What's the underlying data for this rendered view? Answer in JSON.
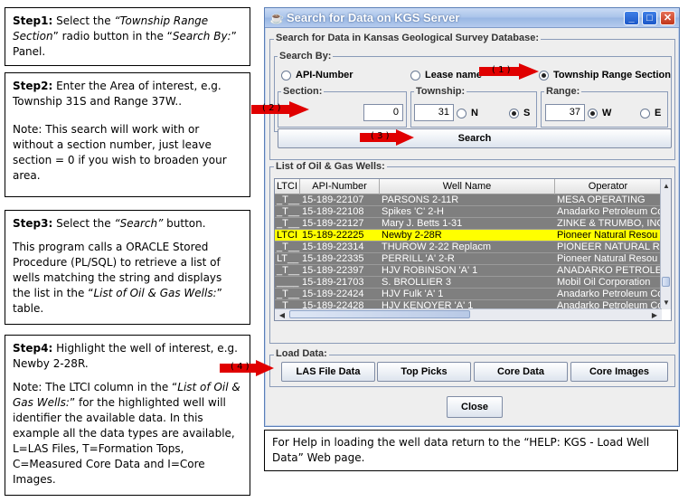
{
  "steps": {
    "s1": {
      "head": "Step1:",
      "t1": " Select the ",
      "i1": "“Township Range Section",
      "t2": "” radio button in the “",
      "i2": "Search By:",
      "t3": "” Panel."
    },
    "s2": {
      "head": "Step2:",
      "t1": " Enter the Area of interest, e.g. Township 31S and Range 37W..",
      "note": "Note: This search will work with or without a section number, just leave section = 0 if you wish to broaden your area."
    },
    "s3": {
      "head": "Step3:",
      "t1": " Select the ",
      "i1": "“Search”",
      "t2": " button.",
      "p2a": "This program calls  a ORACLE Stored Procedure (PL/SQL) to retrieve a list of wells matching the string and displays the list in the “",
      "i2": "List of Oil & Gas Wells:",
      "p2b": "”  table."
    },
    "s4": {
      "head": "Step4:",
      "t1": " Highlight the well of interest, e.g. Newby 2-28R.",
      "n1": "Note: The LTCI column in the “",
      "i1": "List of Oil & Gas Wells:",
      "n2": "” for the highlighted well will identifier the available data. In this example all the data types are available, L=LAS Files, T=Formation Tops, C=Measured Core Data and I=Core Images."
    }
  },
  "window": {
    "title": "Search for Data on KGS Server",
    "db_group": "Search for Data in Kansas Geological Survey Database:",
    "search_by": {
      "label": "Search By:",
      "options": [
        "API-Number",
        "Lease name",
        "Township Range Section"
      ],
      "selected": "Township Range Section"
    },
    "section": {
      "label": "Section:",
      "value": "0"
    },
    "township": {
      "label": "Township:",
      "value": "31",
      "dir_n": "N",
      "dir_s": "S"
    },
    "range": {
      "label": "Range:",
      "value": "37",
      "dir_w": "W",
      "dir_e": "E"
    },
    "search_button": "Search",
    "list_label": "List of Oil & Gas Wells:",
    "columns": [
      "LTCI",
      "API-Number",
      "Well Name",
      "Operator"
    ],
    "rows": [
      [
        "_T__",
        "15-189-22107",
        "PARSONS 2-11R",
        "MESA OPERATING"
      ],
      [
        "_T__",
        "15-189-22108",
        "Spikes 'C' 2-H",
        "Anadarko Petroleum Co"
      ],
      [
        "_T__",
        "15-189-22127",
        "Mary J. Betts 1-31",
        "ZINKE & TRUMBO, INC"
      ],
      [
        "LTCI",
        "15-189-22225",
        "Newby 2-28R",
        "Pioneer Natural Resou"
      ],
      [
        "_T__",
        "15-189-22314",
        "THUROW 2-22 Replacm",
        "PIONEER NATURAL RE"
      ],
      [
        "LT__",
        "15-189-22335",
        "PERRILL 'A' 2-R",
        "Pioneer Natural Resou"
      ],
      [
        "_T__",
        "15-189-22397",
        "HJV ROBINSON 'A' 1",
        "ANADARKO PETROLE"
      ],
      [
        "____",
        "15-189-21703",
        "S. BROLLIER 3",
        "Mobil Oil Corporation"
      ],
      [
        "_T__",
        "15-189-22424",
        "HJV Fulk 'A' 1",
        "Anadarko Petroleum Co"
      ],
      [
        "_T__",
        "15-189-22428",
        "HJV KENOYER 'A' 1",
        "Anadarko Petroleum Co"
      ]
    ],
    "selected_row": 3,
    "load_group": "Load Data:",
    "load_buttons": [
      "LAS File Data",
      "Top Picks",
      "Core Data",
      "Core Images"
    ],
    "close_button": "Close"
  },
  "markers": [
    "( 1 )",
    "( 2 )",
    "( 3 )",
    "( 4 )"
  ],
  "help_text": "For Help in loading the well data return to the “HELP: KGS - Load Well Data” Web page.",
  "colors": {
    "marker_red": "#e00000",
    "row_selected": "#ffff00",
    "row_bg": "#7f7f7f"
  }
}
